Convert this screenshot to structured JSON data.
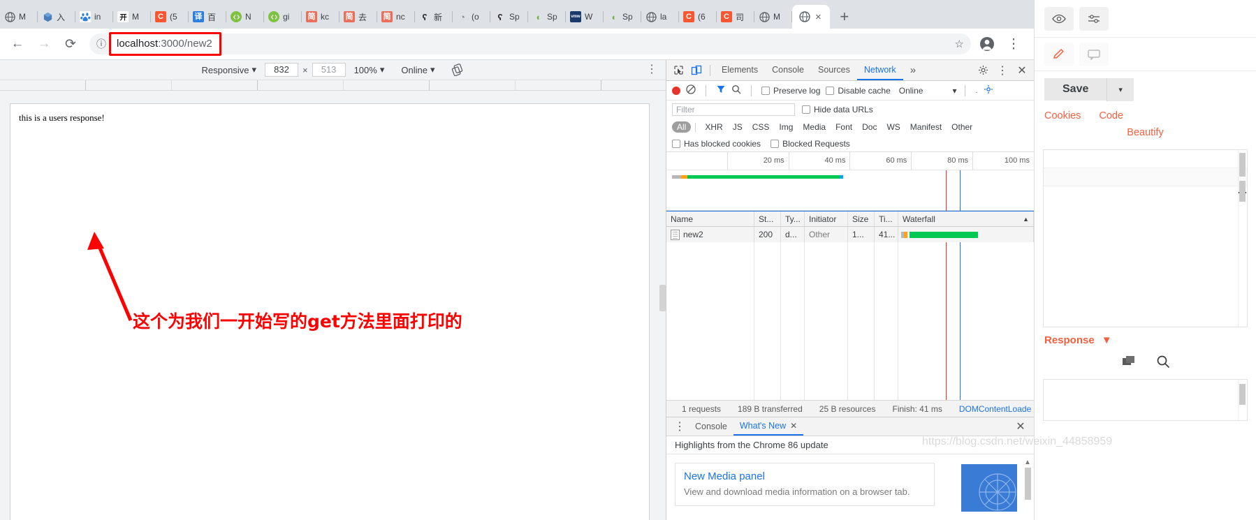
{
  "browser": {
    "tabs": [
      {
        "title": "M",
        "icon": "globe-icon",
        "color": "#5f6368",
        "glyph": "●",
        "kind": "globe"
      },
      {
        "title": "入",
        "icon": "cube-icon",
        "color": "#4a7ebb",
        "glyph": "⬢",
        "kind": "cube"
      },
      {
        "title": "in",
        "icon": "baidu-icon",
        "color": "#ffffff",
        "glyph": "🐾",
        "kind": "baidu"
      },
      {
        "title": "M",
        "icon": "pink-icon",
        "color": "#1a1a1a",
        "glyph": "开",
        "kind": "boxed-dark"
      },
      {
        "title": "(5",
        "icon": "csdn-icon",
        "color": "#fc5531",
        "glyph": "C",
        "kind": "boxed"
      },
      {
        "title": "百",
        "icon": "translate-icon",
        "color": "#2b7fe0",
        "glyph": "译",
        "kind": "boxed"
      },
      {
        "title": "N",
        "icon": "nodejs-icon",
        "color": "#7fc241",
        "glyph": "◉",
        "kind": "round"
      },
      {
        "title": "gi",
        "icon": "gitee-icon",
        "color": "#7fc241",
        "glyph": "◉",
        "kind": "round"
      },
      {
        "title": "kc",
        "icon": "jianshu-icon",
        "color": "#ea6f5a",
        "glyph": "简",
        "kind": "boxed"
      },
      {
        "title": "去",
        "icon": "jianshu-icon",
        "color": "#ea6f5a",
        "glyph": "简",
        "kind": "boxed"
      },
      {
        "title": "nc",
        "icon": "jianshu-icon",
        "color": "#ea6f5a",
        "glyph": "简",
        "kind": "boxed"
      },
      {
        "title": "新",
        "icon": "zhihu-icon",
        "color": "#2f2f2f",
        "glyph": "ʕ",
        "kind": "plain"
      },
      {
        "title": "(o",
        "icon": "turtle-icon",
        "color": "#8a8a8a",
        "glyph": "◔",
        "kind": "plain"
      },
      {
        "title": "Sp",
        "icon": "zhihu-icon",
        "color": "#2f2f2f",
        "glyph": "ʕ",
        "kind": "plain"
      },
      {
        "title": "Sp",
        "icon": "spring-icon",
        "color": "#6db33f",
        "glyph": "◖",
        "kind": "plain"
      },
      {
        "title": "W",
        "icon": "vmware-icon",
        "color": "#1b3a6b",
        "glyph": "vmw",
        "kind": "boxed"
      },
      {
        "title": "Sp",
        "icon": "spring-icon",
        "color": "#6db33f",
        "glyph": "◖",
        "kind": "plain"
      },
      {
        "title": "la",
        "icon": "globe-icon",
        "color": "#5f6368",
        "glyph": "●",
        "kind": "globe"
      },
      {
        "title": "(6",
        "icon": "csdn-icon",
        "color": "#fc5531",
        "glyph": "C",
        "kind": "boxed"
      },
      {
        "title": "司",
        "icon": "csdn-icon",
        "color": "#fc5531",
        "glyph": "C",
        "kind": "boxed"
      },
      {
        "title": "M",
        "icon": "globe-icon",
        "color": "#5f6368",
        "glyph": "●",
        "kind": "globe"
      }
    ],
    "active_tab": {
      "title": "",
      "icon": "globe-icon",
      "close_label": "×"
    },
    "new_tab_label": "+",
    "window_buttons": {
      "minimize": "—",
      "maximize": "☐",
      "close": "✕"
    },
    "nav": {
      "back": "←",
      "forward": "→",
      "reload": "⟳",
      "info_icon": "ⓘ"
    },
    "url": {
      "host": "localhost",
      "rest": ":3000/new2"
    },
    "omnibox_right": {
      "star": "☆",
      "profile": "profile-avatar",
      "menu": "⋮"
    }
  },
  "device_toolbar": {
    "device": "Responsive",
    "device_caret": "▾",
    "width": "832",
    "height": "513",
    "times": "×",
    "zoom": "100%",
    "zoom_caret": "▾",
    "throttling": "Online",
    "throttling_caret": "▾",
    "rotate_icon": "rotate-icon",
    "menu": "⋮"
  },
  "page": {
    "body_text": "this is a users response!",
    "annotation": "这个为我们一开始写的get方法里面打印的",
    "annotation_color": "#ff0000"
  },
  "devtools": {
    "inspect_icon": "inspect-cursor-icon",
    "device_icon": "device-toggle-icon",
    "tabs": [
      {
        "label": "Elements",
        "active": false
      },
      {
        "label": "Console",
        "active": false
      },
      {
        "label": "Sources",
        "active": false
      },
      {
        "label": "Network",
        "active": true
      }
    ],
    "more_tabs": "»",
    "settings_icon": "gear-icon",
    "kebab_icon": "⋮",
    "close_icon": "✕",
    "network": {
      "record_icon": "record-icon",
      "clear_icon": "clear-icon",
      "filter_icon": "filter-funnel-icon",
      "search_icon": "search-icon",
      "preserve_log": "Preserve log",
      "disable_cache": "Disable cache",
      "throttle": "Online",
      "throttle_caret": "▾",
      "import_icon": "import-har-icon",
      "export_icon": "export-har-icon",
      "filter_placeholder": "Filter",
      "hide_data_urls": "Hide data URLs",
      "types": [
        "All",
        "XHR",
        "JS",
        "CSS",
        "Img",
        "Media",
        "Font",
        "Doc",
        "WS",
        "Manifest",
        "Other"
      ],
      "active_type": "All",
      "has_blocked_cookies": "Has blocked cookies",
      "blocked_requests": "Blocked Requests",
      "overview_ticks": [
        "",
        "20 ms",
        "40 ms",
        "60 ms",
        "80 ms",
        "100 ms"
      ],
      "columns": [
        "Name",
        "St...",
        "Ty...",
        "Initiator",
        "Size",
        "Ti...",
        "Waterfall"
      ],
      "sort_caret": "▲",
      "rows": [
        {
          "name": "new2",
          "status": "200",
          "type": "d...",
          "initiator": "Other",
          "size": "1...",
          "time": "41...",
          "icon": "document-icon"
        }
      ],
      "status_bar": {
        "requests": "1 requests",
        "transferred": "189 B transferred",
        "resources": "25 B resources",
        "finish": "Finish: 41 ms",
        "domcontentloaded": "DOMContentLoade"
      }
    },
    "drawer": {
      "kebab": "⋮",
      "tabs": [
        {
          "label": "Console",
          "active": false,
          "closable": false
        },
        {
          "label": "What's New",
          "active": true,
          "closable": true
        }
      ],
      "close_tab_icon": "✕",
      "close_drawer_icon": "✕",
      "heading": "Highlights from the Chrome 86 update",
      "card": {
        "title": "New Media panel",
        "description": "View and download media information on a browser tab."
      },
      "scroll_up_icon": "▲"
    }
  },
  "right_panel": {
    "eye_icon": "eye-icon",
    "settings_icon": "sliders-icon",
    "pencil_icon": "pencil-icon",
    "comment_icon": "comment-icon",
    "save_label": "Save",
    "save_caret": "▾",
    "links": [
      "Cookies",
      "Code"
    ],
    "beautify": "Beautify",
    "response_label": "Response",
    "response_caret": "▼",
    "copy_icon": "copy-icon",
    "search_icon": "search-icon"
  },
  "watermark": "https://blog.csdn.net/weixin_44858959"
}
